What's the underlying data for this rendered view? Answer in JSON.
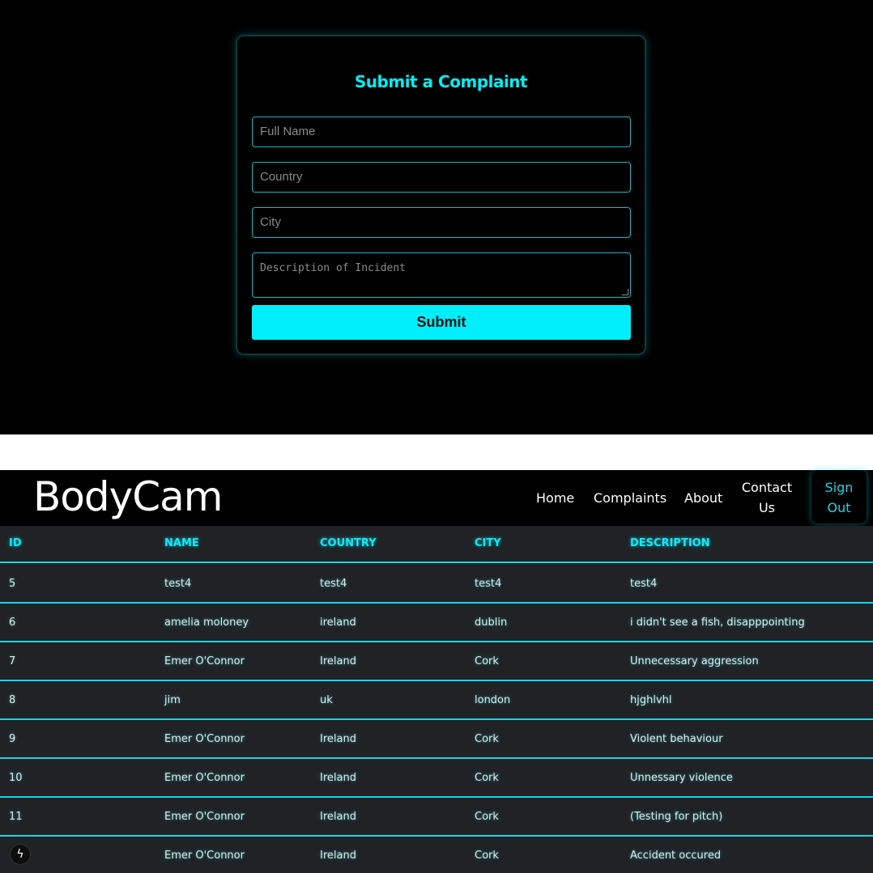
{
  "form": {
    "title": "Submit a Complaint",
    "full_name_placeholder": "Full Name",
    "country_placeholder": "Country",
    "city_placeholder": "City",
    "description_placeholder": "Description of Incident",
    "submit_label": "Submit"
  },
  "navbar": {
    "brand": "BodyCam",
    "links": [
      "Home",
      "Complaints",
      "About"
    ],
    "contact_line1": "Contact",
    "contact_line2": "Us",
    "signout_line1": "Sign",
    "signout_line2": "Out"
  },
  "table": {
    "headers": [
      "ID",
      "NAME",
      "COUNTRY",
      "CITY",
      "DESCRIPTION"
    ],
    "rows": [
      [
        "5",
        "test4",
        "test4",
        "test4",
        "test4"
      ],
      [
        "6",
        "amelia moloney",
        "ireland",
        "dublin",
        "i didn't see a fish, disapppointing"
      ],
      [
        "7",
        "Emer O'Connor",
        "Ireland",
        "Cork",
        "Unnecessary aggression"
      ],
      [
        "8",
        "jim",
        "uk",
        "london",
        "hjghlvhl"
      ],
      [
        "9",
        "Emer O'Connor",
        "Ireland",
        "Cork",
        "Violent behaviour"
      ],
      [
        "10",
        "Emer O'Connor",
        "Ireland",
        "Cork",
        "Unnessary violence"
      ],
      [
        "11",
        "Emer O'Connor",
        "Ireland",
        "Cork",
        "(Testing for pitch)"
      ],
      [
        "",
        "Emer O'Connor",
        "Ireland",
        "Cork",
        "Accident occured"
      ]
    ]
  },
  "icons": {
    "dev_badge": "lightning-bolt-icon"
  },
  "colors": {
    "accent": "#00eefa",
    "background": "#000000",
    "table_bg": "#202225"
  }
}
